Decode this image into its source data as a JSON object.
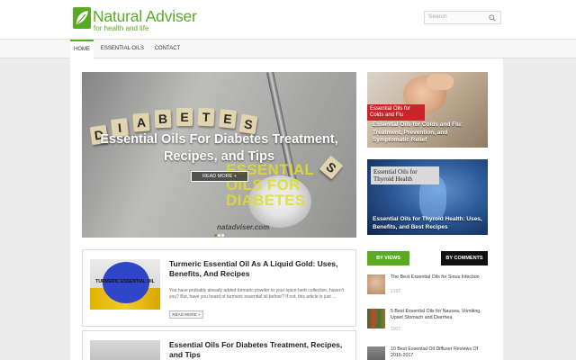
{
  "brand": {
    "title": "Natural Adviser",
    "tagline": "for health and life",
    "color": "#5aab23"
  },
  "search": {
    "placeholder": "Search",
    "icon": "search-icon"
  },
  "nav": {
    "items": [
      {
        "label": "HOME",
        "active": true
      },
      {
        "label": "ESSENTIAL OILS",
        "active": false
      },
      {
        "label": "CONTACT",
        "active": false
      }
    ]
  },
  "hero": {
    "title": "Essential Oils For Diabetes Treatment, Recipes, and Tips",
    "read_more": "READ MORE +",
    "image_overlay_text": "ESSENTIAL OILS FOR DIABETES",
    "image_site": "natadviser.com",
    "tiles": [
      "D",
      "I",
      "A",
      "B",
      "E",
      "T",
      "E",
      "S"
    ]
  },
  "side_cards": [
    {
      "label": "Essential Oils for Colds and Flu",
      "caption": "Essential Oils for Colds and Flu: Treatment, Prevention, and Symptomatic Relief"
    },
    {
      "label": "Essential Oils for Thyroid Health",
      "caption": "Essential Oils for Thyroid Health: Uses, Benefits, and Best Recipes"
    }
  ],
  "tabs": {
    "views": "BY VIEWS",
    "comments": "BY COMMENTS"
  },
  "popular": [
    {
      "title": "The Best Essential Oils for Sinus Infection",
      "count": "2192"
    },
    {
      "title": "5 Best Essential Oils for Nausea, Vomiting, Upset Stomach and Diarrhea",
      "count": "1007"
    },
    {
      "title": "10 Best Essential Oil Diffuser Reviews Of 2016-2017",
      "count": ""
    }
  ],
  "posts": [
    {
      "title": "Turmeric Essential Oil As A Liquid Gold: Uses, Benefits, And Recipes",
      "thumb_text": "TURMERIC ESSENTIAL OIL",
      "excerpt": "You have probably already added turmeric powder to your spice-herb collection, haven't you? But, have you heard of turmeric essential oil before? If not, this article is just ...",
      "read_more": "READ MORE +"
    },
    {
      "title": "Essential Oils For Diabetes Treatment, Recipes, and Tips"
    }
  ],
  "colors": {
    "accent": "#5aab23",
    "dark_tab": "#111111",
    "label_red": "#c8252a"
  }
}
